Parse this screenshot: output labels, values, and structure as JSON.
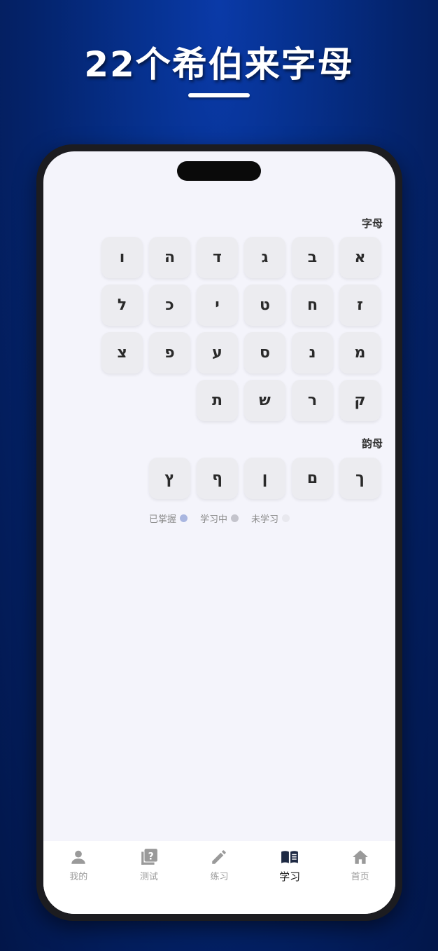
{
  "headline": "22个希伯来字母",
  "sections": {
    "letters_label": "字母",
    "finals_label": "韵母"
  },
  "letters": [
    [
      "א",
      "ב",
      "ג",
      "ד",
      "ה",
      "ו"
    ],
    [
      "ז",
      "ח",
      "ט",
      "י",
      "כ",
      "ל"
    ],
    [
      "מ",
      "נ",
      "ס",
      "ע",
      "פ",
      "צ"
    ],
    [
      "ק",
      "ר",
      "ש",
      "ת"
    ]
  ],
  "finals": [
    "ך",
    "ם",
    "ן",
    "ף",
    "ץ"
  ],
  "legend": [
    {
      "label": "已掌握",
      "color": "#a9b6e0"
    },
    {
      "label": "学习中",
      "color": "#c4c4cc"
    },
    {
      "label": "未学习",
      "color": "#e8e8ee"
    }
  ],
  "tabs": [
    {
      "label": "我的",
      "icon": "person-icon",
      "active": false
    },
    {
      "label": "测试",
      "icon": "quiz-icon",
      "active": false
    },
    {
      "label": "练习",
      "icon": "pencil-icon",
      "active": false
    },
    {
      "label": "学习",
      "icon": "book-icon",
      "active": true
    },
    {
      "label": "首页",
      "icon": "home-icon",
      "active": false
    }
  ]
}
